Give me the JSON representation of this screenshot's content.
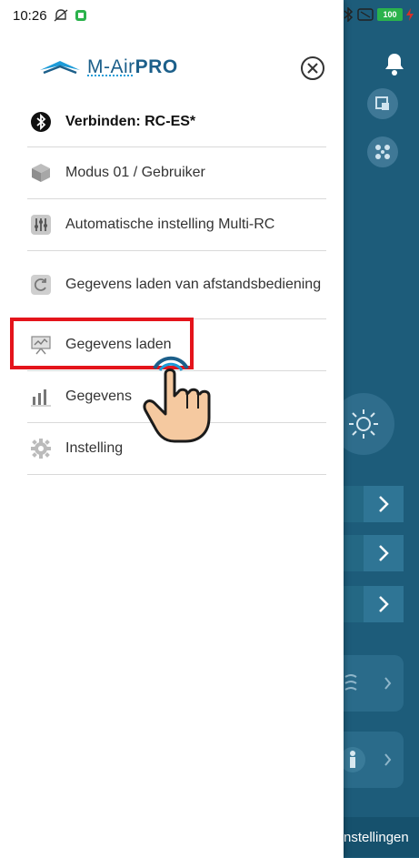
{
  "status_bar": {
    "time": "10:26",
    "battery": "100"
  },
  "drawer": {
    "logo_text_left": "M-Air",
    "logo_text_right": "PRO",
    "close_icon": "close-circle-icon",
    "menu": [
      {
        "label": "Verbinden: RC-ES*",
        "icon": "bluetooth-icon",
        "bold": true
      },
      {
        "label": "Modus 01 / Gebruiker",
        "icon": "cube-icon"
      },
      {
        "label": "Automatische instelling Multi-RC",
        "icon": "sliders-icon"
      },
      {
        "label": "Gegevens laden van afstandsbediening",
        "icon": "refresh-icon"
      },
      {
        "label": "Gegevens laden",
        "icon": "chart-board-icon"
      },
      {
        "label": "Gegevens",
        "icon": "bar-chart-icon"
      },
      {
        "label": "Instelling",
        "icon": "gear-icon"
      }
    ]
  },
  "background": {
    "bottom_label": "nstellingen",
    "accent": "#1d5c7a"
  },
  "highlight_color": "#e4141b"
}
